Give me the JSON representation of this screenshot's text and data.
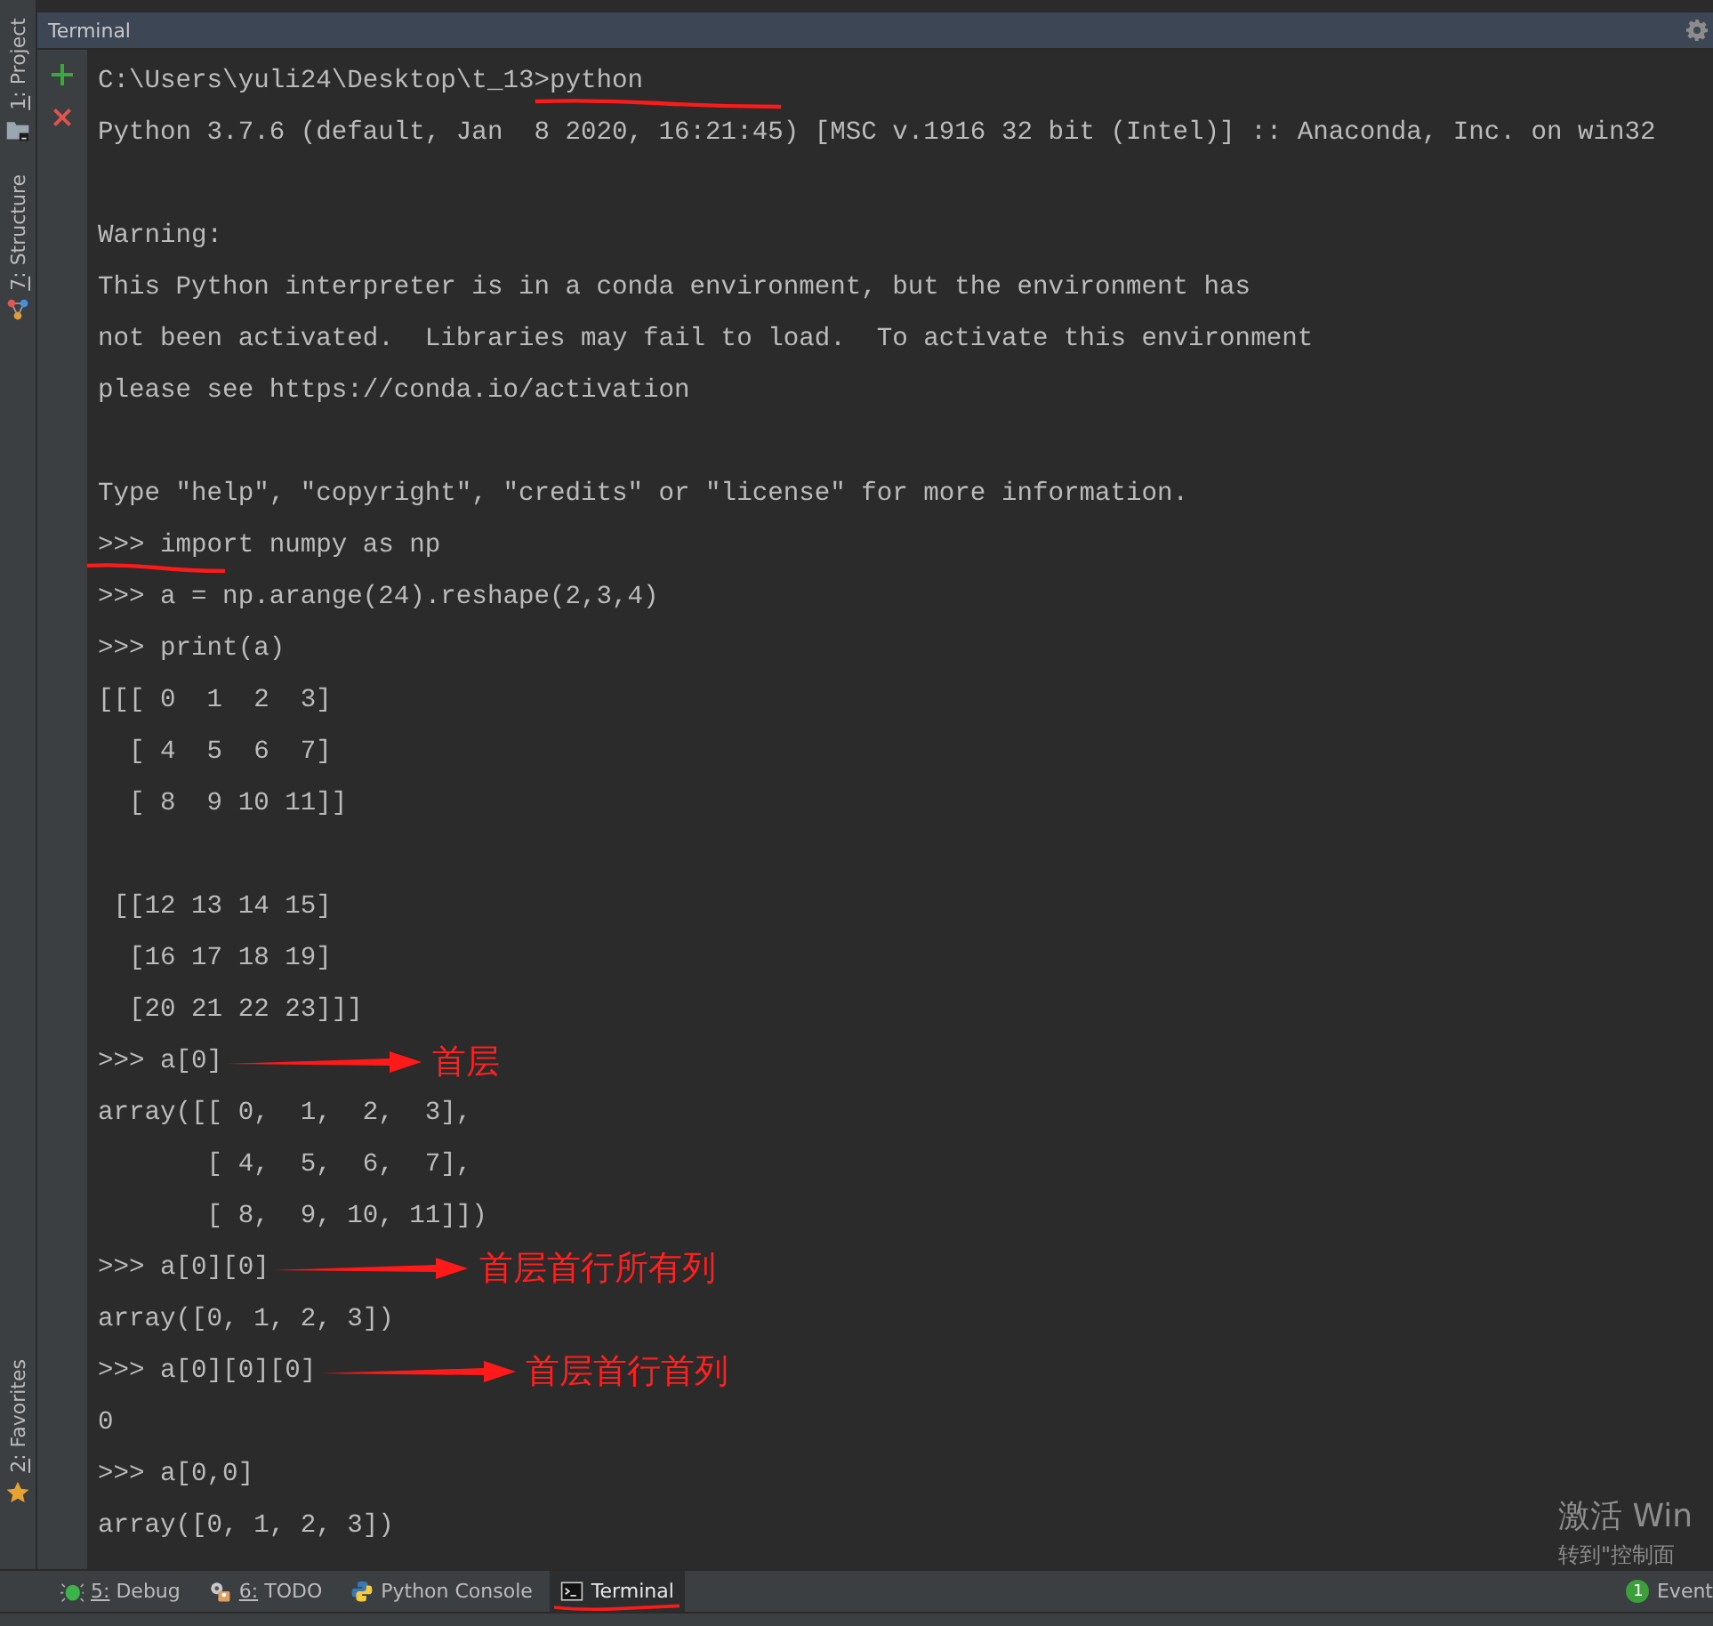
{
  "side_tabs_top": [
    {
      "label": "1: Project",
      "mnemonic": true
    },
    {
      "label": "7: Structure",
      "mnemonic": true
    }
  ],
  "side_tabs_bottom": [
    {
      "label": "2: Favorites",
      "mnemonic": true
    }
  ],
  "panel": {
    "title": "Terminal"
  },
  "terminal": {
    "lines": [
      {
        "kind": "text",
        "text": "C:\\Users\\yuli24\\Desktop\\t_13>python",
        "underlined": true
      },
      {
        "kind": "text",
        "text": "Python 3.7.6 (default, Jan  8 2020, 16:21:45) [MSC v.1916 32 bit (Intel)] :: Anaconda, Inc. on win32"
      },
      {
        "kind": "blank"
      },
      {
        "kind": "text",
        "text": "Warning:"
      },
      {
        "kind": "text",
        "text": "This Python interpreter is in a conda environment, but the environment has"
      },
      {
        "kind": "text",
        "text": "not been activated.  Libraries may fail to load.  To activate this environment"
      },
      {
        "kind": "text",
        "text": "please see https://conda.io/activation"
      },
      {
        "kind": "blank"
      },
      {
        "kind": "text",
        "text": "Type \"help\", \"copyright\", \"credits\" or \"license\" for more information."
      },
      {
        "kind": "text",
        "text": ">>> import numpy as np",
        "underlined": true
      },
      {
        "kind": "text",
        "text": ">>> a = np.arange(24).reshape(2,3,4)"
      },
      {
        "kind": "text",
        "text": ">>> print(a)"
      },
      {
        "kind": "text",
        "text": "[[[ 0  1  2  3]"
      },
      {
        "kind": "text",
        "text": "  [ 4  5  6  7]"
      },
      {
        "kind": "text",
        "text": "  [ 8  9 10 11]]"
      },
      {
        "kind": "blank"
      },
      {
        "kind": "text",
        "text": " [[12 13 14 15]"
      },
      {
        "kind": "text",
        "text": "  [16 17 18 19]"
      },
      {
        "kind": "text",
        "text": "  [20 21 22 23]]]"
      },
      {
        "kind": "text",
        "text": ">>> a[0]",
        "note": "首层"
      },
      {
        "kind": "text",
        "text": "array([[ 0,  1,  2,  3],"
      },
      {
        "kind": "text",
        "text": "       [ 4,  5,  6,  7],"
      },
      {
        "kind": "text",
        "text": "       [ 8,  9, 10, 11]])"
      },
      {
        "kind": "text",
        "text": ">>> a[0][0]",
        "note": "首层首行所有列"
      },
      {
        "kind": "text",
        "text": "array([0, 1, 2, 3])"
      },
      {
        "kind": "text",
        "text": ">>> a[0][0][0]",
        "note": "首层首行首列"
      },
      {
        "kind": "text",
        "text": "0"
      },
      {
        "kind": "text",
        "text": ">>> a[0,0]"
      },
      {
        "kind": "text",
        "text": "array([0, 1, 2, 3])"
      }
    ]
  },
  "activation_notice": [
    "激活 Win",
    "转到\"控制面"
  ],
  "bottom_tabs": [
    {
      "label": "5: Debug",
      "mnemonic": true,
      "selected": false,
      "underlined": false
    },
    {
      "label": "6: TODO",
      "mnemonic": true,
      "selected": false,
      "underlined": false
    },
    {
      "label": "Python Console",
      "mnemonic": false,
      "selected": false,
      "underlined": false
    },
    {
      "label": "Terminal",
      "mnemonic": false,
      "selected": true,
      "underlined": true
    }
  ],
  "event_log": {
    "label": "Event",
    "count": "1"
  }
}
